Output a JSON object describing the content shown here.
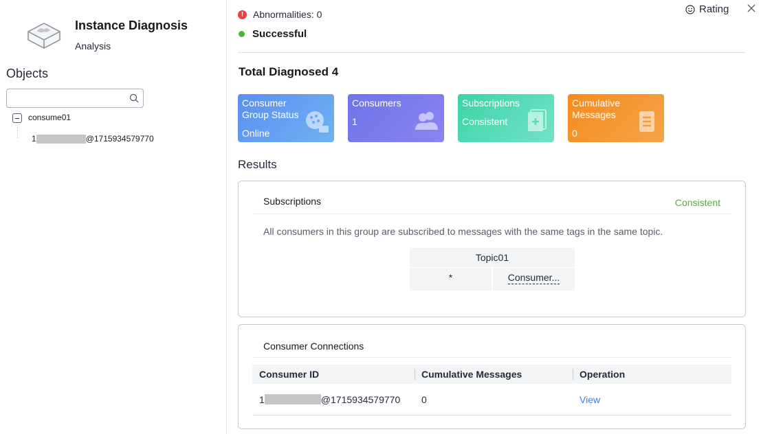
{
  "sidebar": {
    "title": "Instance Diagnosis",
    "subtitle": "Analysis",
    "objects_label": "Objects",
    "search_placeholder": "",
    "tree": {
      "root": "consume01",
      "child_prefix": "1",
      "child_suffix": "@1715934579770"
    }
  },
  "header": {
    "abnormalities": "Abnormalities: 0",
    "status": "Successful",
    "rating": "Rating"
  },
  "summary": {
    "title": "Total Diagnosed 4",
    "cards": [
      {
        "label": "Consumer Group Status",
        "value": "Online"
      },
      {
        "label": "Consumers",
        "value": "1"
      },
      {
        "label": "Subscriptions",
        "value": "Consistent"
      },
      {
        "label": "Cumulative Messages",
        "value": "0"
      }
    ]
  },
  "results": {
    "title": "Results",
    "subscriptions": {
      "title": "Subscriptions",
      "status": "Consistent",
      "description": "All consumers in this group are subscribed to messages with the same tags in the same topic.",
      "topic": "Topic01",
      "tag": "*",
      "consumer": "Consumer..."
    },
    "connections": {
      "title": "Consumer Connections",
      "columns": [
        "Consumer ID",
        "Cumulative Messages",
        "Operation"
      ],
      "rows": [
        {
          "id_prefix": "1",
          "id_suffix": "@1715934579770",
          "messages": "0",
          "operation": "View"
        }
      ]
    }
  },
  "colors": {
    "success": "#50b136",
    "error": "#e84141",
    "link": "#3a7ce8"
  }
}
